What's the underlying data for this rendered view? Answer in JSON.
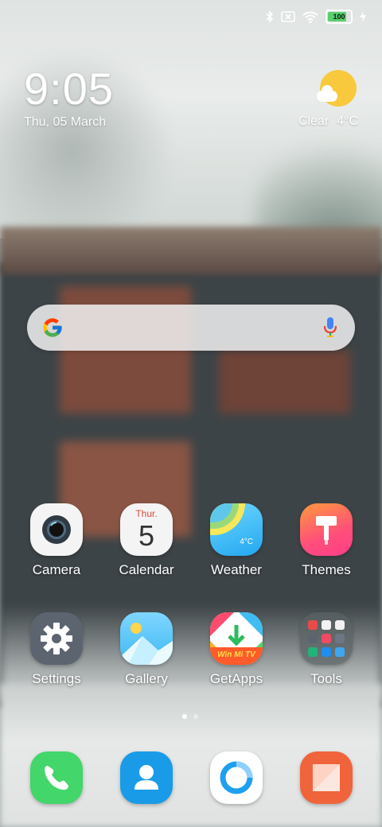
{
  "status_bar": {
    "icons": [
      "bluetooth-icon",
      "no-sim-icon",
      "wifi-icon",
      "battery-icon",
      "charging-icon"
    ],
    "battery_level": "100",
    "battery_color": "#59d06b"
  },
  "clock": {
    "time": "9:05",
    "date": "Thu, 05 March"
  },
  "weather": {
    "condition": "Clear",
    "temperature": "4°C",
    "icon": "sun-cloud-icon"
  },
  "search": {
    "logo": "google-g-icon",
    "mic": "mic-icon"
  },
  "apps": {
    "row1": [
      {
        "label": "Camera",
        "icon": "camera-icon"
      },
      {
        "label": "Calendar",
        "icon": "calendar-icon",
        "day_name": "Thur.",
        "day_number": "5"
      },
      {
        "label": "Weather",
        "icon": "weather-icon",
        "temp": "4°C"
      },
      {
        "label": "Themes",
        "icon": "themes-icon"
      }
    ],
    "row2": [
      {
        "label": "Settings",
        "icon": "gear-icon"
      },
      {
        "label": "Gallery",
        "icon": "gallery-icon"
      },
      {
        "label": "GetApps",
        "icon": "getapps-icon",
        "banner": "Win Mi TV"
      },
      {
        "label": "Tools",
        "icon": "tools-folder-icon"
      }
    ]
  },
  "page_indicator": {
    "pages": 2,
    "current": 1
  },
  "dock": [
    {
      "icon": "phone-icon",
      "color": "#43d66b"
    },
    {
      "icon": "contacts-icon",
      "color": "#1a9be8"
    },
    {
      "icon": "browser-icon",
      "color": "#ffffff"
    },
    {
      "icon": "notes-icon",
      "color": "#f0643c"
    }
  ]
}
